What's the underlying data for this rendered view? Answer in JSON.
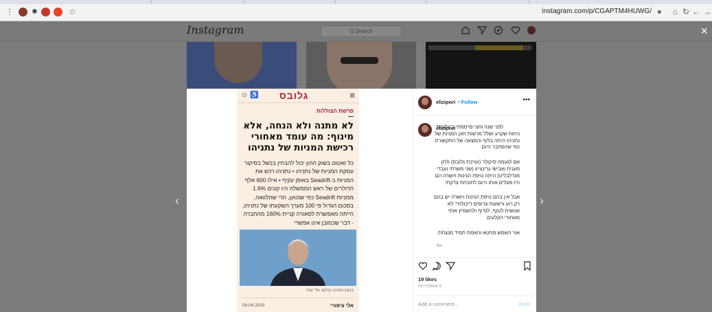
{
  "browser": {
    "url": "instagram.com/p/CGAPTM4HUWG/",
    "toolbar_glyphs": {
      "menu": "⋮",
      "star": "☆",
      "lock": "🔒",
      "home": "⌂",
      "reload": "↻",
      "back": "←",
      "forward": "→"
    }
  },
  "instagram": {
    "logo": "Instagram",
    "search_placeholder": "Q Search",
    "nav_icons": [
      "home-icon",
      "direct-icon",
      "explore-icon",
      "activity-heart-icon",
      "profile-avatar"
    ]
  },
  "modal": {
    "close_glyph": "×",
    "prev_glyph": "‹",
    "next_glyph": "›",
    "article": {
      "logo": "גלובס",
      "kicker": "פרשת הצוללות",
      "title": "לא מתנה ולא הנחה, אלא מינוף: מה עומד מאחורי רכישת המניות של נתניהו",
      "body": "כל זאטוט בשוק ההון יכול להבחין בכשל בסיקור עסקת המניות של נתניהו • נתניהו רכש את המניות ב-Seadrift באופן עקיף • אילו 600 אלף הדולרים של ראש הממשלה היו קונים 1.6% ממניות Seadrift כפי שנטען, הרי שהלוואה, בסכום הגדול פי 100 מערך השקעתו של נתניהו, הייתה מאפשרת לסאורה קניית 160% מהחברה - דבר שכמובן אינו אפשרי",
      "photo_caption": "בנימין נתניהו / צילום: אלי יצחר",
      "author": "אלי ציפורי",
      "date": "04.04.2019"
    },
    "post": {
      "username": "elizipori",
      "follow": "• Follow",
      "more": "•••",
      "caption_paragraphs": [
        "לפני שנה וחצי פרסמתי ב\"גלובס\" ניתוח שקרע ושלל מרשות חוק המניות של נתניהו היתה בלוף והמצאה של התקשורת. כפי שהסתבר היום.",
        "אם לגעמה סיקולר (עורכת גלובס) ולחן מענית ואבישי גרינצייג (שני משרתי ועבדי מנדלבליט) היתה טיפת הגינות ויושרה הם היו מעלים אותו היום לחוכחת צדקתי.",
        "אבל אין בהם טיפת הגינות ויושרה יש בהם רק רוע ורשעות צרופים ו\"יכולתי\" לא אנושית לטנף, לגדוף ולהשמיץ אותי מאחורי הקלעים.",
        "אור השמש מחטא והאמת תמיד מנצחת."
      ],
      "age": "6w",
      "likes": "19 likes",
      "date": "OCTOBER 6",
      "comment_placeholder": "Add a comment...",
      "post_label": "Post"
    }
  },
  "colors": {
    "globes_red": "#b0233a",
    "ig_blue": "#0095f6",
    "overlay_gray": "#7b7b7b"
  }
}
